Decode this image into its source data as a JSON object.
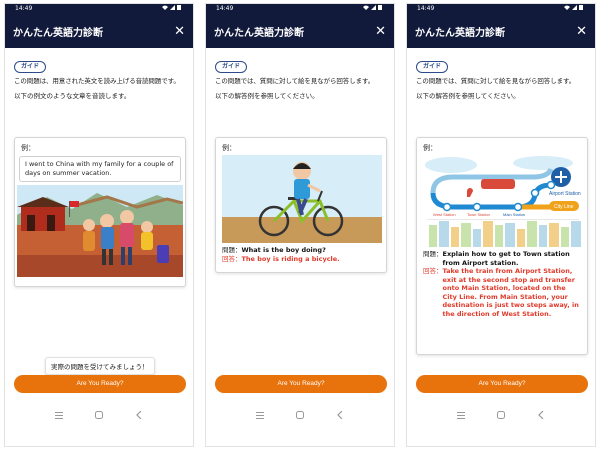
{
  "screens": [
    {
      "status_time": "14:49",
      "app_title": "かんたん英語力診断",
      "close_glyph": "✕",
      "guide_badge": "ガイド",
      "description": "この問題は、用意された英文を読み上げる音読問題です。",
      "instruction": "以下の例文のような文章を音読します。",
      "example_label": "例：",
      "example_text": "I went to China with my family for a couple of days on summer vacation.",
      "toast": "実際の問題を受けてみましょう！",
      "button": "Are You Ready?"
    },
    {
      "status_time": "14:49",
      "app_title": "かんたん英語力診断",
      "close_glyph": "✕",
      "guide_badge": "ガイド",
      "description": "この問題では、質問に対して絵を見ながら回答します。",
      "instruction": "以下の解答例を参照してください。",
      "example_label": "例：",
      "question_label": "問題：",
      "question": "What is the boy doing?",
      "answer_label": "回答：",
      "answer": "The boy is riding a bicycle.",
      "button": "Are You Ready?"
    },
    {
      "status_time": "14:49",
      "app_title": "かんたん英語力診断",
      "close_glyph": "✕",
      "guide_badge": "ガイド",
      "description": "この問題では、質問に対して絵を見ながら回答します。",
      "instruction": "以下の解答例を参照してください。",
      "example_label": "例：",
      "map_labels": {
        "airport": "Airport Station",
        "west": "West Station",
        "town": "Town Station",
        "main": "Main Station",
        "city_line": "City Line"
      },
      "question_label": "問題：",
      "question": "Explain how to get to Town station from Airport station.",
      "answer_label": "回答：",
      "answer": "Take the train from Airport Station, exit at the second stop and transfer onto Main Station, located on the City Line. From Main Station, your destination is just two steps away, in the direction of West Station.",
      "button": "Are You Ready?"
    }
  ],
  "icons": {
    "status": [
      "wifi-icon",
      "signal-icon",
      "battery-icon"
    ],
    "nav": [
      "recent-apps-icon",
      "home-icon",
      "back-icon"
    ]
  },
  "colors": {
    "appbar": "#121a3c",
    "button": "#e8720c",
    "answer": "#e03a2a",
    "badge_border": "#2d4a8a"
  }
}
